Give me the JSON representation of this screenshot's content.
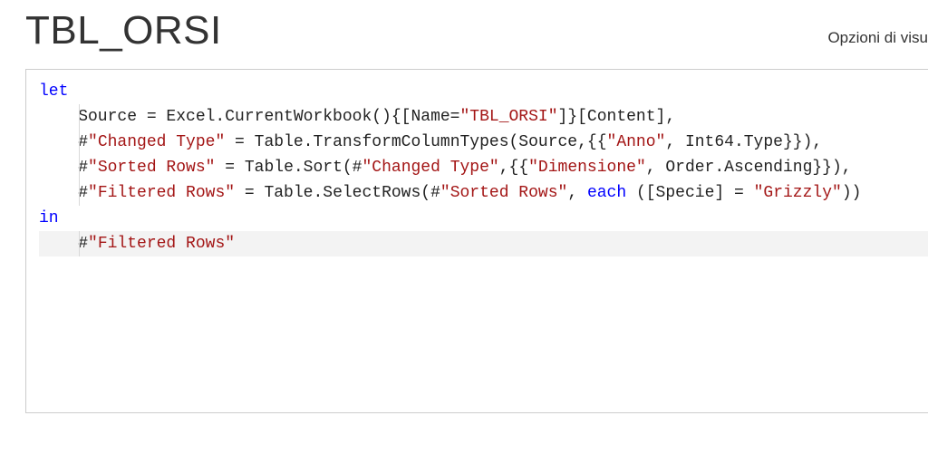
{
  "header": {
    "title": "TBL_ORSI",
    "options_label": "Opzioni di visu"
  },
  "code": {
    "l1_kw": "let",
    "l2_a": "    Source = Excel.CurrentWorkbook(){[Name=",
    "l2_s": "\"TBL_ORSI\"",
    "l2_b": "]}[Content],",
    "l3_a": "    #",
    "l3_s1": "\"Changed Type\"",
    "l3_b": " = Table.TransformColumnTypes(Source,{{",
    "l3_s2": "\"Anno\"",
    "l3_c": ", Int64.Type}}),",
    "l4_a": "    #",
    "l4_s1": "\"Sorted Rows\"",
    "l4_b": " = Table.Sort(#",
    "l4_s2": "\"Changed Type\"",
    "l4_c": ",{{",
    "l4_s3": "\"Dimensione\"",
    "l4_d": ", Order.Ascending}}),",
    "l5_a": "    #",
    "l5_s1": "\"Filtered Rows\"",
    "l5_b": " = Table.SelectRows(#",
    "l5_s2": "\"Sorted Rows\"",
    "l5_c": ", ",
    "l5_kw": "each",
    "l5_d": " ([Specie] = ",
    "l5_s3": "\"Grizzly\"",
    "l5_e": "))",
    "l6_kw": "in",
    "l7_a": "    #",
    "l7_s1": "\"Filtered Rows\""
  }
}
